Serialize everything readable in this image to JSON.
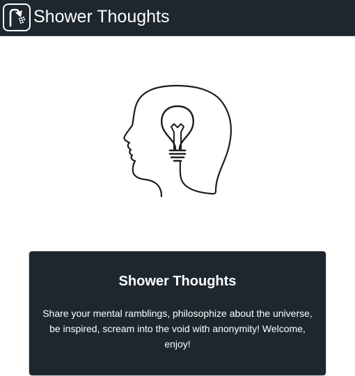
{
  "header": {
    "logo_icon": "shower-head-icon",
    "title": "Shower Thoughts",
    "background": "#1e272e"
  },
  "hero": {
    "icon": "head-lightbulb-icon"
  },
  "intro_card": {
    "title": "Shower Thoughts",
    "text": "Share your mental ramblings, philosophize about the universe, be inspired, scream into the void with anonymity! Welcome, enjoy!",
    "background": "#1e272e"
  }
}
